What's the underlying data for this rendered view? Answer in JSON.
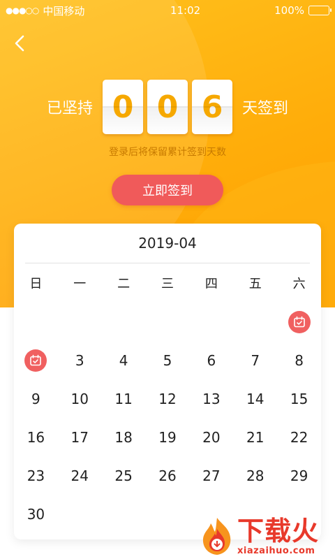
{
  "status_bar": {
    "signal_dots": "●●●○○",
    "carrier": "中国移动",
    "time": "11:02",
    "battery": "100%"
  },
  "header": {
    "back_icon": "chevron-left-icon"
  },
  "streak": {
    "prefix": "已坚持",
    "digits": [
      "0",
      "0",
      "6"
    ],
    "suffix": "天签到",
    "hint": "登录后将保留累计签到天数"
  },
  "signin_button": {
    "label": "立即签到"
  },
  "calendar": {
    "month_label": "2019-04",
    "weekdays": [
      "日",
      "一",
      "二",
      "三",
      "四",
      "五",
      "六"
    ],
    "leading_blanks": 6,
    "days": [
      {
        "label": "",
        "checked": true
      },
      {
        "label": "",
        "checked": true
      },
      {
        "label": "3",
        "checked": false
      },
      {
        "label": "4",
        "checked": false
      },
      {
        "label": "5",
        "checked": false
      },
      {
        "label": "6",
        "checked": false
      },
      {
        "label": "7",
        "checked": false
      },
      {
        "label": "8",
        "checked": false
      },
      {
        "label": "9",
        "checked": false
      },
      {
        "label": "10",
        "checked": false
      },
      {
        "label": "11",
        "checked": false
      },
      {
        "label": "12",
        "checked": false
      },
      {
        "label": "13",
        "checked": false
      },
      {
        "label": "14",
        "checked": false
      },
      {
        "label": "15",
        "checked": false
      },
      {
        "label": "16",
        "checked": false
      },
      {
        "label": "17",
        "checked": false
      },
      {
        "label": "18",
        "checked": false
      },
      {
        "label": "19",
        "checked": false
      },
      {
        "label": "20",
        "checked": false
      },
      {
        "label": "21",
        "checked": false
      },
      {
        "label": "22",
        "checked": false
      },
      {
        "label": "23",
        "checked": false
      },
      {
        "label": "24",
        "checked": false
      },
      {
        "label": "25",
        "checked": false
      },
      {
        "label": "26",
        "checked": false
      },
      {
        "label": "27",
        "checked": false
      },
      {
        "label": "28",
        "checked": false
      },
      {
        "label": "29",
        "checked": false
      },
      {
        "label": "30",
        "checked": false
      }
    ],
    "checked_icon": "calendar-check-icon"
  },
  "watermark": {
    "text_cn": "下载火",
    "text_en": "xiazaihuo.com"
  },
  "colors": {
    "hero_orange": "#ffad0a",
    "digit_orange": "#f6a800",
    "button_red": "#f05a5a",
    "badge_red": "#f06060",
    "hint_brown": "#c77a00"
  }
}
